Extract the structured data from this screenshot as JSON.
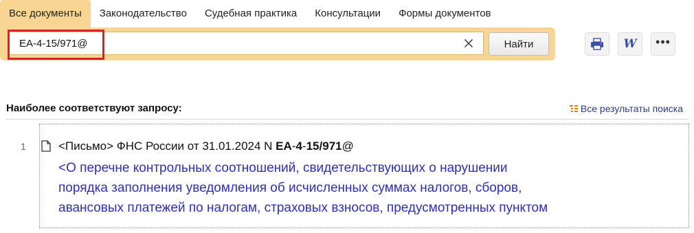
{
  "tabs": [
    {
      "label": "Все документы",
      "active": true
    },
    {
      "label": "Законодательство",
      "active": false
    },
    {
      "label": "Судебная практика",
      "active": false
    },
    {
      "label": "Консультации",
      "active": false
    },
    {
      "label": "Формы документов",
      "active": false
    }
  ],
  "search": {
    "query": "ЕА-4-15/971@",
    "find_label": "Найти",
    "clear_icon": "close-icon"
  },
  "toolbar": {
    "print_icon": "printer-icon",
    "word_icon": "word-icon",
    "word_letter": "W",
    "more_label": "•••"
  },
  "results": {
    "heading": "Наиболее соответствуют запросу:",
    "all_results_label": "Все результаты поиска",
    "items": [
      {
        "number": "1",
        "title_prefix": "<Письмо> ФНС России от 31.01.2024 N ",
        "title_code_parts": [
          "ЕА",
          "-",
          "4",
          "-",
          "15",
          "/",
          "971",
          "@"
        ],
        "description_lines": [
          "<О перечне контрольных соотношений, свидетельствующих о нарушении",
          "порядка заполнения уведомления об исчисленных суммах налогов, сборов,",
          "авансовых платежей по налогам, страховых взносов, предусмотренных пунктом"
        ]
      }
    ]
  },
  "colors": {
    "accent_panel": "#f9d593",
    "highlight_border": "#e01e2a",
    "link_blue": "#2e2fb8"
  }
}
